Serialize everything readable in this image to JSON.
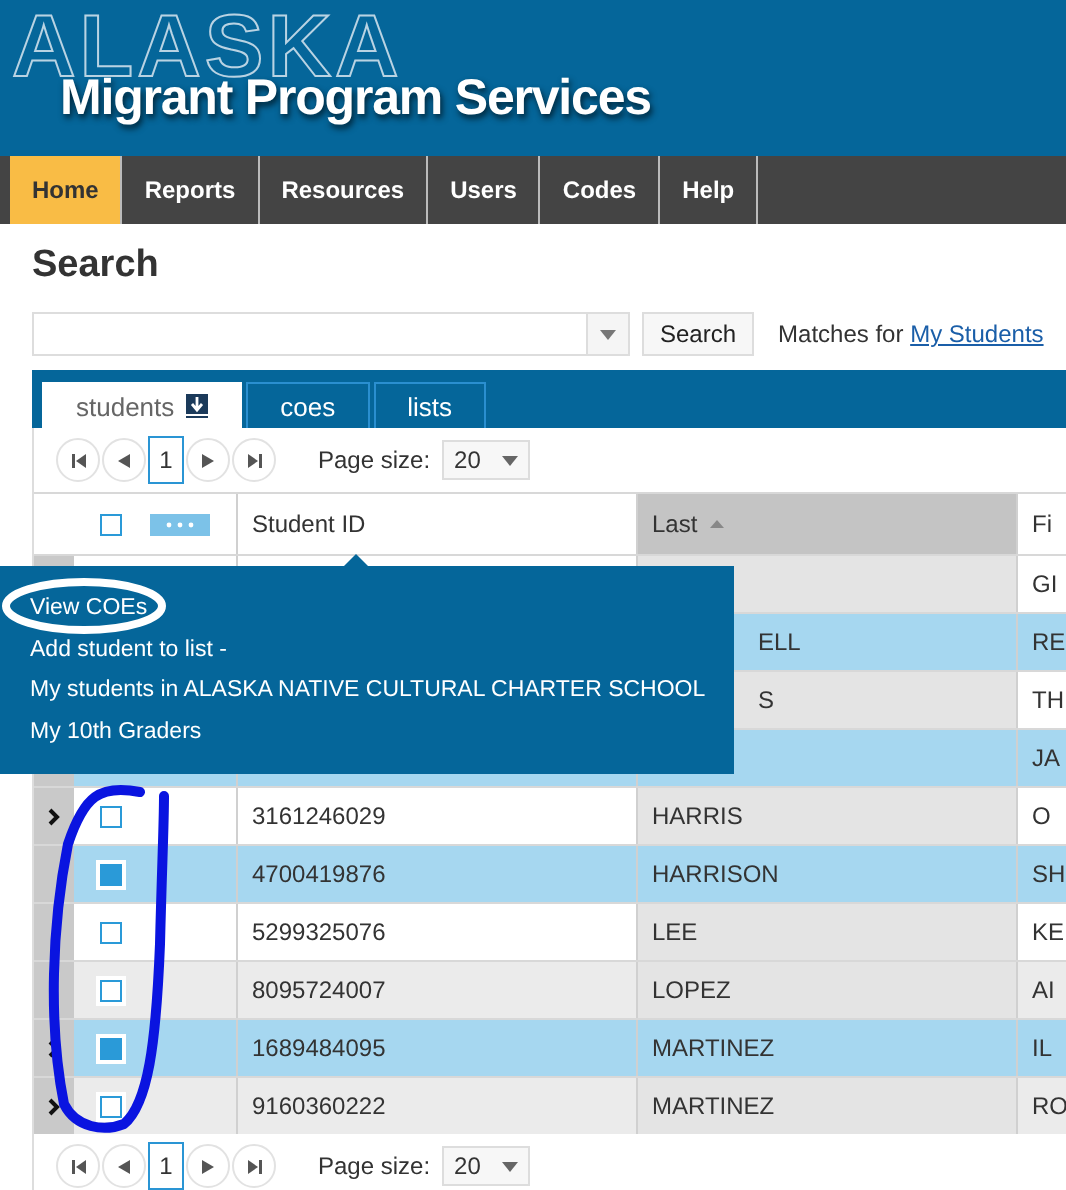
{
  "header": {
    "watermark": "ALASKA",
    "title": "Migrant Program Services"
  },
  "nav": [
    {
      "label": "Home",
      "selected": true
    },
    {
      "label": "Reports",
      "selected": false
    },
    {
      "label": "Resources",
      "selected": false
    },
    {
      "label": "Users",
      "selected": false
    },
    {
      "label": "Codes",
      "selected": false
    },
    {
      "label": "Help",
      "selected": false
    }
  ],
  "page_title": "Search",
  "search": {
    "button": "Search",
    "matches_label": "Matches for",
    "matches_link": "My Students"
  },
  "tabs": [
    {
      "label": "students",
      "selected": true,
      "download": true
    },
    {
      "label": "coes",
      "selected": false,
      "download": false
    },
    {
      "label": "lists",
      "selected": false,
      "download": false
    }
  ],
  "pagers": [
    {
      "page": "1",
      "page_size_label": "Page size:",
      "page_size": "20"
    },
    {
      "page": "1",
      "page_size_label": "Page size:",
      "page_size": "20"
    }
  ],
  "table": {
    "all_checked": false,
    "columns": [
      {
        "label": "Student ID",
        "sorted": false
      },
      {
        "label": "Last",
        "sorted": true
      },
      {
        "label": "Fi",
        "sorted": false
      }
    ],
    "rows": [
      {
        "expandable": false,
        "checked": false,
        "covered": false,
        "student_id": "",
        "last": "",
        "first": "GI"
      },
      {
        "expandable": false,
        "checked": true,
        "covered": true,
        "student_id": "",
        "last": "ELL",
        "first": "RE"
      },
      {
        "expandable": false,
        "checked": false,
        "covered": true,
        "student_id": "",
        "last": "S",
        "first": "TH"
      },
      {
        "expandable": false,
        "checked": true,
        "covered": false,
        "student_id": "",
        "last": "",
        "first": "JA"
      },
      {
        "expandable": true,
        "checked": false,
        "covered": false,
        "student_id": "3161246029",
        "last": "HARRIS",
        "first": "O"
      },
      {
        "expandable": false,
        "checked": true,
        "covered": false,
        "student_id": "4700419876",
        "last": "HARRISON",
        "first": "SH"
      },
      {
        "expandable": false,
        "checked": false,
        "covered": false,
        "student_id": "5299325076",
        "last": "LEE",
        "first": "KE"
      },
      {
        "expandable": false,
        "checked": false,
        "covered": false,
        "student_id": "8095724007",
        "last": "LOPEZ",
        "first": "AI"
      },
      {
        "expandable": true,
        "checked": true,
        "covered": false,
        "student_id": "1689484095",
        "last": "MARTINEZ",
        "first": "IL"
      },
      {
        "expandable": true,
        "checked": false,
        "covered": false,
        "student_id": "9160360222",
        "last": "MARTINEZ",
        "first": "RO"
      }
    ]
  },
  "context_menu": {
    "items": [
      "View COEs",
      "Add student to list -",
      "My students in ALASKA NATIVE CULTURAL CHARTER SCHOOL",
      "My 10th Graders"
    ]
  }
}
